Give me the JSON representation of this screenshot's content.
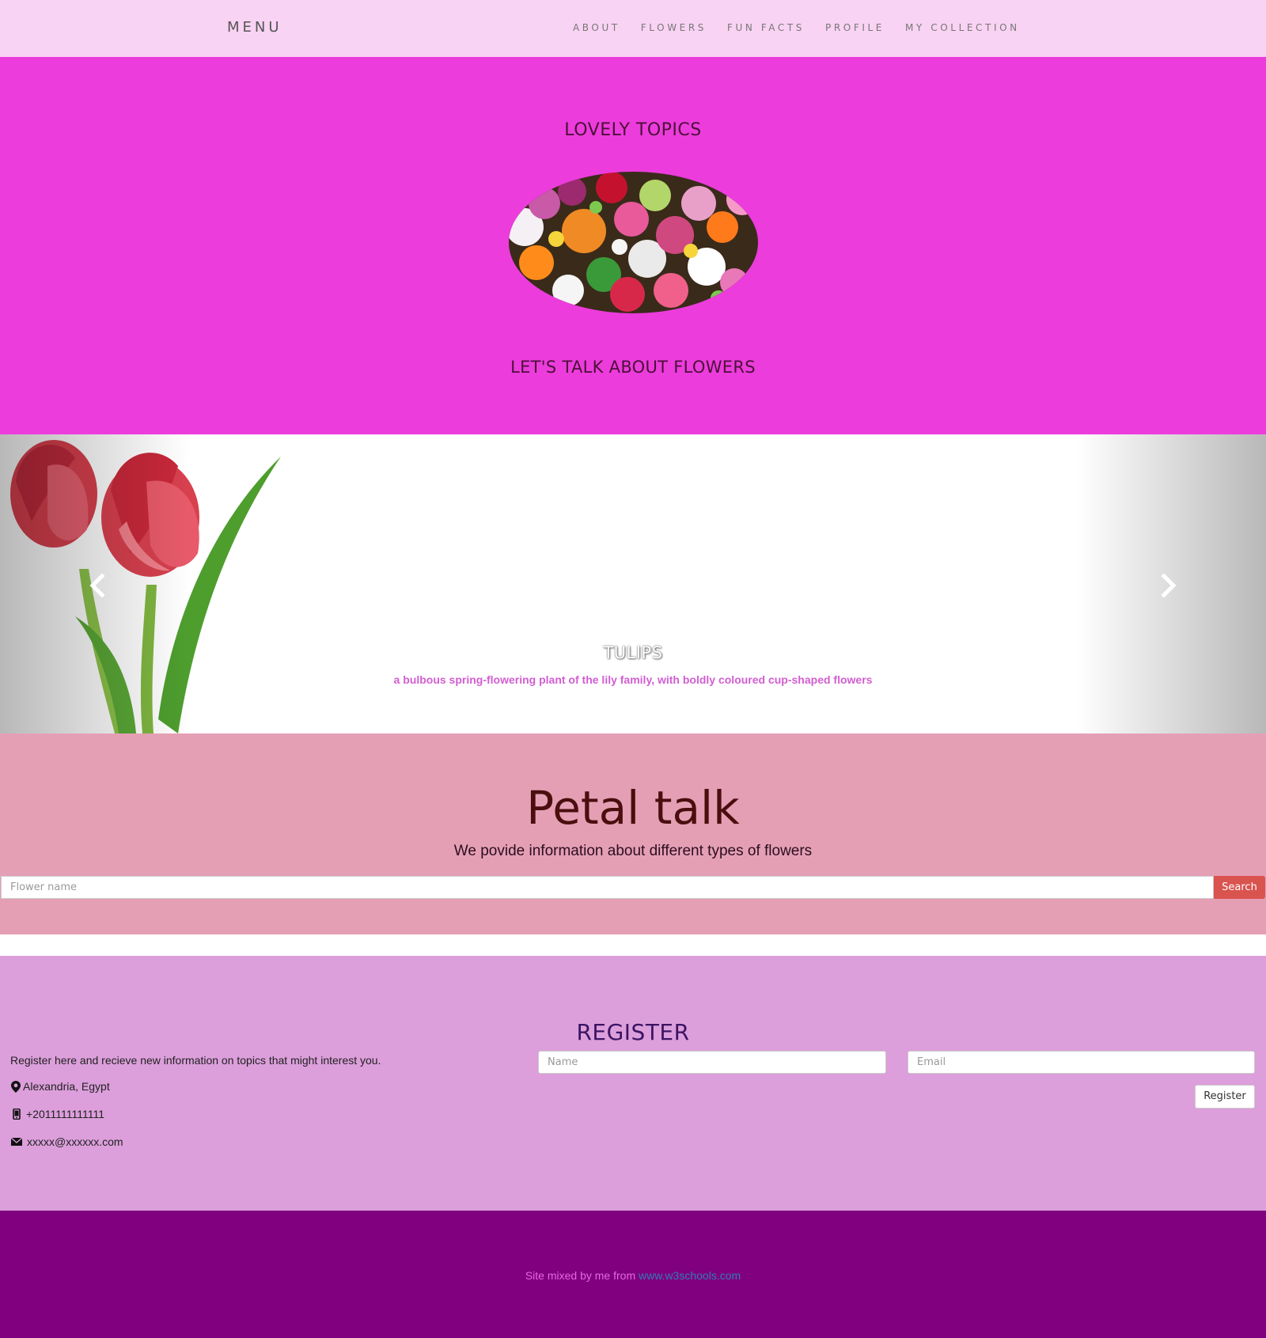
{
  "navbar": {
    "brand": "MENU",
    "links": [
      "ABOUT",
      "FLOWERS",
      "FUN FACTS",
      "PROFILE",
      "MY COLLECTION"
    ]
  },
  "hero": {
    "title": "LOVELY TOPICS",
    "subtitle": "LET'S TALK ABOUT FLOWERS"
  },
  "carousel": {
    "slide_title": "TULIPS",
    "slide_caption": "a bulbous spring-flowering plant of the lily family, with boldly coloured cup-shaped flowers",
    "prev_icon": "chevron-left-icon",
    "next_icon": "chevron-right-icon"
  },
  "petal": {
    "title": "Petal talk",
    "subtitle": "We povide information about different types of flowers",
    "search_placeholder": "Flower name",
    "search_button": "Search"
  },
  "register": {
    "title": "REGISTER",
    "blurb": "Register here and recieve new information on topics that might interest you.",
    "location": "Alexandria, Egypt",
    "phone": "+2011111111111",
    "email": "xxxxx@xxxxxx.com",
    "name_placeholder": "Name",
    "email_placeholder": "Email",
    "button": "Register"
  },
  "footer": {
    "text": "Site mixed by me from",
    "link": "www.w3schools.com"
  },
  "colors": {
    "navbar_bg": "#f9d3f3",
    "hero_bg": "#ec3cdc",
    "petal_bg": "#e59fb5",
    "register_bg": "#dc9fdb",
    "footer_bg": "#800080",
    "search_button": "#d9534f"
  }
}
